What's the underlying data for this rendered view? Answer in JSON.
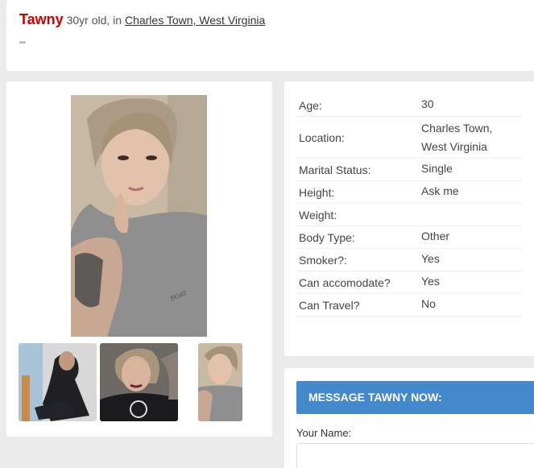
{
  "header": {
    "name": "Tawny",
    "age_text": "30yr old, in",
    "location": "Charles Town, West Virginia",
    "quote": "\"\""
  },
  "photos": {
    "main": "profile-photo",
    "thumbnails": [
      "thumbnail-1",
      "thumbnail-2",
      "thumbnail-3"
    ]
  },
  "details": [
    {
      "label": "Age:",
      "value": "30"
    },
    {
      "label": "Location:",
      "value_lines": [
        "Charles Town,",
        "West Virginia"
      ]
    },
    {
      "label": "Marital Status:",
      "value": "Single"
    },
    {
      "label": "Height:",
      "value": "Ask me"
    },
    {
      "label": "Weight:",
      "value": ""
    },
    {
      "label": "Body Type:",
      "value": "Other"
    },
    {
      "label": "Smoker?:",
      "value": "Yes"
    },
    {
      "label": "Can accomodate?",
      "value": "Yes"
    },
    {
      "label": "Can Travel?",
      "value": "No"
    }
  ],
  "message": {
    "prefix": "MESSAGE",
    "name": "TAWNY",
    "suffix": "NOW:",
    "your_name_label": "Your Name:",
    "your_name_value": ""
  },
  "colors": {
    "name_red": "#cc0000",
    "message_blue": "#4389cb",
    "background": "#ebebeb"
  }
}
